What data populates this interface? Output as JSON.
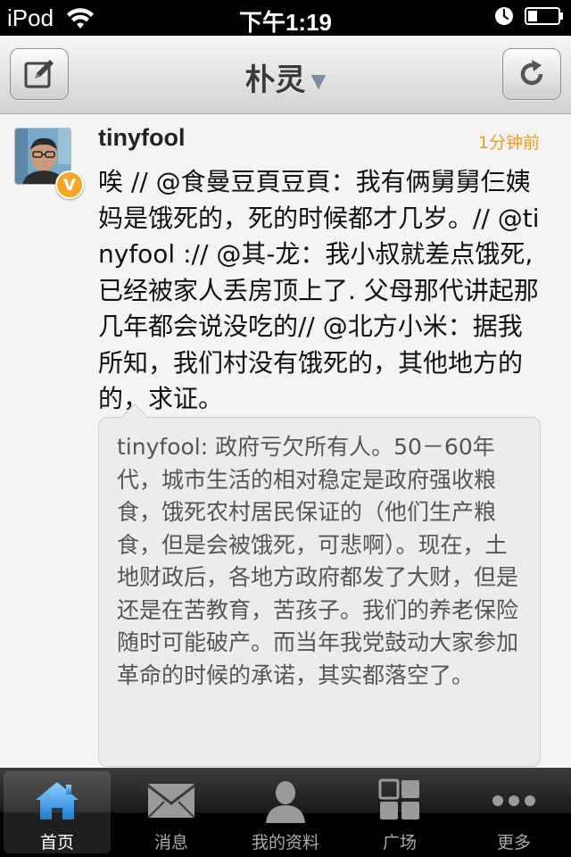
{
  "status_bar": {
    "carrier": "iPod",
    "time": "下午1:19"
  },
  "nav": {
    "title": "朴灵",
    "left_icon": "compose-icon",
    "right_icon": "refresh-icon"
  },
  "post": {
    "username": "tinyfool",
    "timestamp": "1分钟前",
    "text": "唉 // @食曼豆頁豆頁：我有俩舅舅仨姨妈是饿死的，死的时候都才几岁。// @tinyfool :// @其-龙：我小叔就差点饿死,已经被家人丢房顶上了. 父母那代讲起那几年都会说没吃的// @北方小米：据我所知，我们村没有饿死的，其他地方的的，求证。",
    "verified_badge": "V",
    "repost": {
      "text": "tinyfool: 政府亏欠所有人。50－60年代，城市生活的相对稳定是政府强收粮食，饿死农村居民保证的（他们生产粮食，但是会被饿死，可悲啊）。现在，土地财政后，各地方政府都发了大财，但是还是在苦教育，苦孩子。我们的养老保险随时可能破产。而当年我党鼓动大家参加革命的时候的承诺，其实都落空了。"
    }
  },
  "tabs": [
    {
      "label": "首页",
      "icon": "home-icon",
      "active": true
    },
    {
      "label": "消息",
      "icon": "envelope-icon",
      "active": false
    },
    {
      "label": "我的资料",
      "icon": "person-icon",
      "active": false
    },
    {
      "label": "广场",
      "icon": "grid-icon",
      "active": false
    },
    {
      "label": "更多",
      "icon": "more-dots-icon",
      "active": false
    }
  ],
  "colors": {
    "timestamp": "#f09a27",
    "home_icon_blue": "#3aa0e8",
    "badge": "#f5a623"
  }
}
